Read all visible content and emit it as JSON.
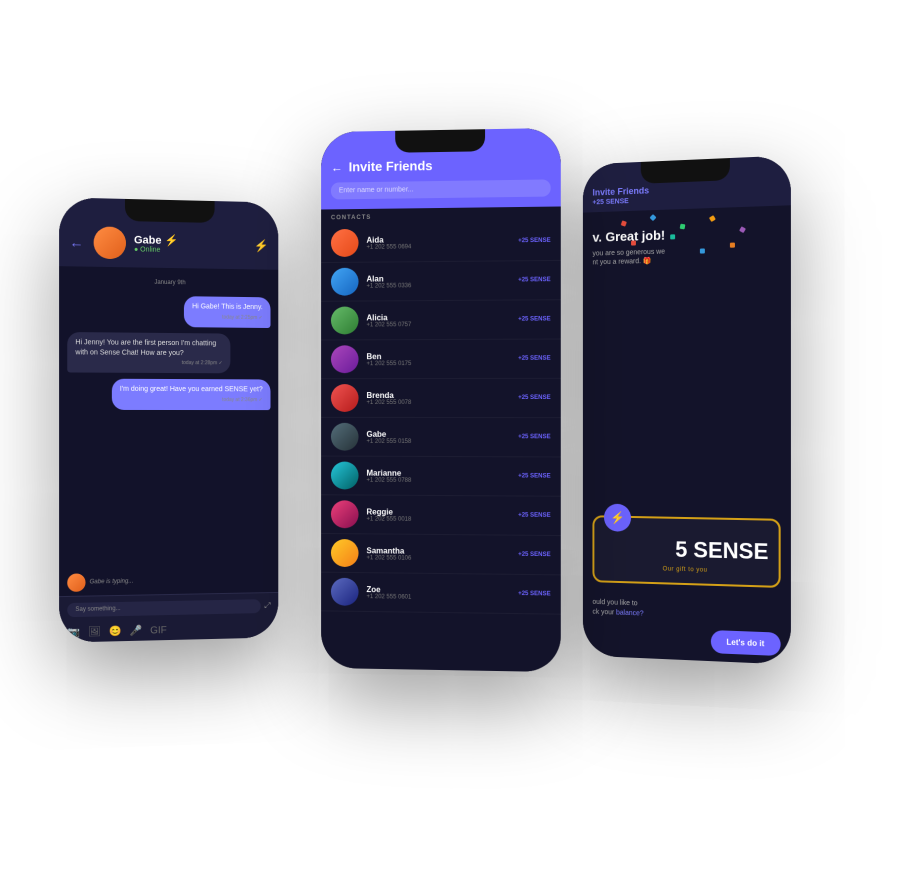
{
  "phones": {
    "chat": {
      "header": {
        "back": "←",
        "name": "Gabe ⚡",
        "status": "● Online",
        "bolt": "⚡"
      },
      "date_label": "January 9th",
      "messages": [
        {
          "type": "sent",
          "text": "Hi Gabe! This is Jenny.",
          "time": "today at 2:25pm ✓"
        },
        {
          "type": "received",
          "text": "Hi Jenny!  You are the first person I'm chatting with on Sense Chat! How are you?",
          "time": "today at 2:28pm ✓"
        },
        {
          "type": "sent",
          "text": "I'm doing great! Have you earned SENSE yet?",
          "time": "today at 2:36pm ✓"
        }
      ],
      "typing": "Gabe is typing...",
      "input_placeholder": "Say something...",
      "icons": [
        "📷",
        "🖼",
        "😊",
        "🎤",
        "GIF"
      ]
    },
    "invite": {
      "title": "Invite Friends",
      "back": "←",
      "search_placeholder": "Enter name or number...",
      "contacts_label": "CONTACTS",
      "contacts": [
        {
          "name": "Aida",
          "phone": "+1 202 555 0694",
          "action": "+25 SENSE",
          "av": "av-orange"
        },
        {
          "name": "Alan",
          "phone": "+1 202 555 0336",
          "action": "+25 SENSE",
          "av": "av-blue"
        },
        {
          "name": "Alicia",
          "phone": "+1 202 555 0757",
          "action": "+25 SENSE",
          "av": "av-green"
        },
        {
          "name": "Ben",
          "phone": "+1 202 555 0175",
          "action": "+25 SENSE",
          "av": "av-purple"
        },
        {
          "name": "Brenda",
          "phone": "+1 202 555 0078",
          "action": "+25 SENSE",
          "av": "av-red"
        },
        {
          "name": "Gabe",
          "phone": "+1 202 555 0158",
          "action": "+25 SENSE",
          "av": "av-dark"
        },
        {
          "name": "Marianne",
          "phone": "+1 202 555 0788",
          "action": "+25 SENSE",
          "av": "av-teal"
        },
        {
          "name": "Reggie",
          "phone": "+1 202 555 0018",
          "action": "+25 SENSE",
          "av": "av-pink"
        },
        {
          "name": "Samantha",
          "phone": "+1 202 555 0106",
          "action": "+25 SENSE",
          "av": "av-amber"
        },
        {
          "name": "Zoe",
          "phone": "+1 202 555 0601",
          "action": "+25 SENSE",
          "av": "av-indigo"
        }
      ]
    },
    "reward": {
      "header_title": "Invite Friends",
      "badge": "+25 SENSE",
      "congrats": "v. Great job!",
      "subtitle": "you are so generous we\nnt you a reward. 🎁",
      "amount": "5 SENSE",
      "gift_label": "Our gift to you",
      "question": "ould you like to\nck your balance?",
      "balance_link": "balance?",
      "btn_label": "Let's do it"
    }
  }
}
